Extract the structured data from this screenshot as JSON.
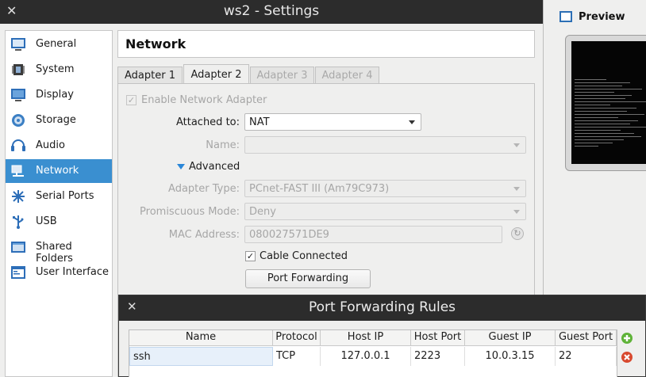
{
  "window": {
    "title": "ws2 - Settings",
    "close_glyph": "✕"
  },
  "preview": {
    "title": "Preview"
  },
  "sidebar": {
    "items": [
      {
        "label": "General",
        "icon": "general-icon"
      },
      {
        "label": "System",
        "icon": "system-icon"
      },
      {
        "label": "Display",
        "icon": "display-icon"
      },
      {
        "label": "Storage",
        "icon": "storage-icon"
      },
      {
        "label": "Audio",
        "icon": "audio-icon"
      },
      {
        "label": "Network",
        "icon": "network-icon",
        "selected": true
      },
      {
        "label": "Serial Ports",
        "icon": "serial-ports-icon"
      },
      {
        "label": "USB",
        "icon": "usb-icon"
      },
      {
        "label": "Shared Folders",
        "icon": "shared-folders-icon"
      },
      {
        "label": "User Interface",
        "icon": "user-interface-icon"
      }
    ]
  },
  "page": {
    "title": "Network"
  },
  "tabs": [
    {
      "label": "Adapter 1",
      "active": false,
      "enabled": true
    },
    {
      "label": "Adapter 2",
      "active": true,
      "enabled": true
    },
    {
      "label": "Adapter 3",
      "active": false,
      "enabled": false
    },
    {
      "label": "Adapter 4",
      "active": false,
      "enabled": false
    }
  ],
  "adapter": {
    "enable_label": "Enable Network Adapter",
    "enable_checked": true,
    "attached_label": "Attached to:",
    "attached_value": "NAT",
    "name_label": "Name:",
    "name_value": "",
    "advanced_label": "Advanced",
    "adapter_type_label": "Adapter Type:",
    "adapter_type_value": "PCnet-FAST III (Am79C973)",
    "promisc_label": "Promiscuous Mode:",
    "promisc_value": "Deny",
    "mac_label": "MAC Address:",
    "mac_value": "080027571DE9",
    "cable_label": "Cable Connected",
    "cable_checked": true,
    "port_forwarding_label": "Port Forwarding"
  },
  "port_forwarding": {
    "title": "Port Forwarding Rules",
    "close_glyph": "✕",
    "columns": [
      "Name",
      "Protocol",
      "Host IP",
      "Host Port",
      "Guest IP",
      "Guest Port"
    ],
    "rows": [
      [
        "ssh",
        "TCP",
        "127.0.0.1",
        "2223",
        "10.0.3.15",
        "22"
      ]
    ]
  },
  "colors": {
    "selection": "#3a8fd0",
    "titlebar": "#2c2c2c",
    "accent_triangle": "#2a86d8"
  }
}
